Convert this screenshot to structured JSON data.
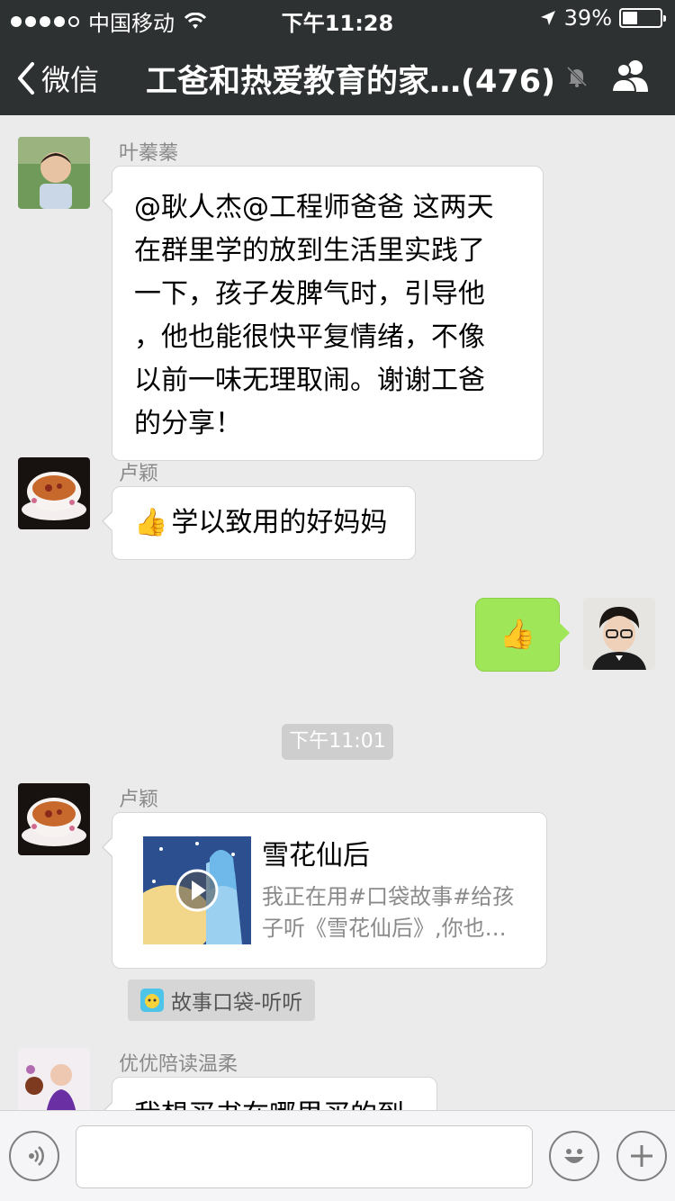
{
  "status_bar": {
    "carrier": "中国移动",
    "time": "下午11:28",
    "battery": "39%",
    "battery_level": 0.39
  },
  "nav": {
    "back_label": "微信",
    "title": "工爸和热爱教育的家…(476)",
    "icons": [
      "chevron-left-icon",
      "mute-icon",
      "group-members-icon"
    ]
  },
  "messages": [
    {
      "sender": "叶蓁蓁",
      "side": "left",
      "text_lines": [
        "@耿人杰@工程师爸爸 这两天",
        "在群里学的放到生活里实践了",
        "一下，孩子发脾气时，引导他",
        "，他也能很快平复情绪，不像",
        "以前一味无理取闹。谢谢工爸",
        "的分享！"
      ]
    },
    {
      "sender": "卢颖",
      "side": "left",
      "emoji": "👍",
      "text": "学以致用的好妈妈"
    },
    {
      "side": "right",
      "emoji": "👍"
    },
    {
      "type": "time",
      "text": "下午11:01"
    },
    {
      "sender": "卢颖",
      "side": "left",
      "card": {
        "title": "雪花仙后",
        "desc_lines": [
          "我正在用#口袋故事#给孩",
          "子听《雪花仙后》,你也…"
        ],
        "source": "故事口袋-听听"
      }
    },
    {
      "sender": "优优陪读温柔",
      "side": "left",
      "text": "我想买书在哪里买的到"
    }
  ],
  "input_bar": {
    "icons": [
      "voice-icon",
      "emoji-icon",
      "plus-icon"
    ]
  },
  "colors": {
    "nav_bg": "#2e3132",
    "chat_bg": "#ebebeb",
    "self_bubble": "#9fe658"
  }
}
